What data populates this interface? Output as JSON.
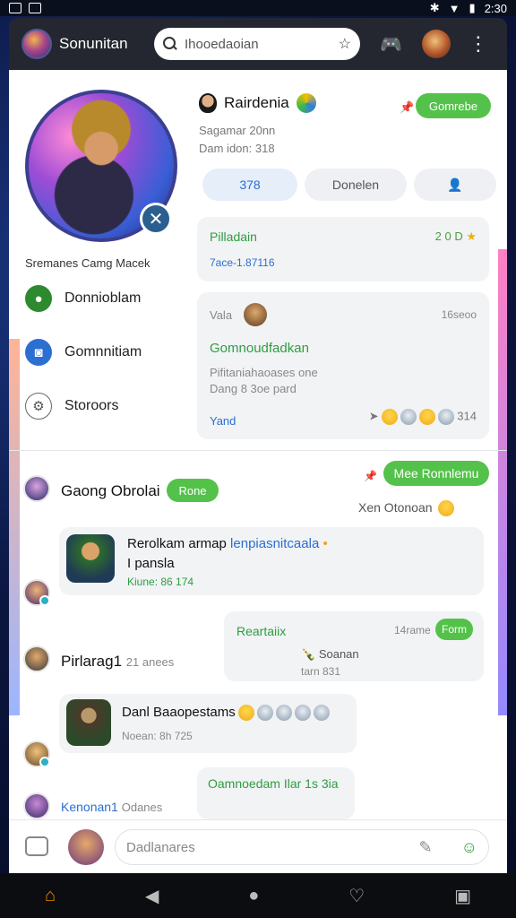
{
  "status": {
    "time": "2:30"
  },
  "app_bar": {
    "title": "Sonunitan",
    "search_placeholder": "Ihooedaoian"
  },
  "profile": {
    "caption": "Sremanes Camg Macek"
  },
  "sidebar": {
    "items": [
      {
        "label": "Donnioblam",
        "icon": "game-icon",
        "color": "#2e8a2e"
      },
      {
        "label": "Gomnnitiam",
        "icon": "camera-icon",
        "color": "#2b6fd1"
      },
      {
        "label": "Storoors",
        "icon": "settings-icon",
        "color": "#ffffff"
      }
    ]
  },
  "user": {
    "name": "Rairdenia",
    "line1": "Sagamar 20nn",
    "line2": "Dam idon: 318",
    "action": "Gomrebe"
  },
  "tabs": [
    {
      "label": "378"
    },
    {
      "label": "Donelen"
    },
    {
      "label": ""
    }
  ],
  "card1": {
    "title": "Pilladain",
    "meta": "2 0 D",
    "link": "7ace-1.87116"
  },
  "card2": {
    "label": "Vala",
    "time": "16seoo",
    "title": "Gomnoudfadkan",
    "line1": "Pifitaniahaoases one",
    "line2": "Dang 8 3oe pard",
    "link": "Yand",
    "count": "314"
  },
  "chat": {
    "header_name": "Gaong Obrolai",
    "header_pill": "Rone",
    "me_pill": "Mee Ronnlemu",
    "me_sub": "Xen Otonoan",
    "msg1": {
      "title": "Rerolkam armap",
      "title_blue": "lenpiasnitcaala",
      "line2": "I pansla",
      "meta": "Kiune: 86 174"
    },
    "msg2": {
      "title": "Reartaiix",
      "time": "14rame",
      "pill": "Form",
      "line1": "Soanan",
      "line2": "tarn 831"
    },
    "row3": {
      "name": "Pirlarag1",
      "sub": "21 anees"
    },
    "msg3": {
      "title": "Danl Baaopestams",
      "meta": "Noean: 8h 725"
    },
    "msg4": {
      "title": "Oamnoedam Ilar 1s 3ia"
    },
    "row5": {
      "name": "Kenonan1",
      "sub": "Odanes"
    }
  },
  "input": {
    "placeholder": "Dadlanares"
  }
}
